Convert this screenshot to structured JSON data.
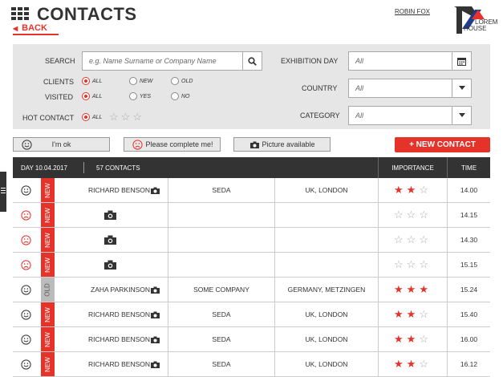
{
  "header": {
    "title": "CONTACTS",
    "back_label": "BACK",
    "user_name": "ROBIN FOX",
    "logo_line1": "LOREM",
    "logo_line2": "HOUSE"
  },
  "filters": {
    "search_label": "SEARCH",
    "search_placeholder": "e.g. Name Surname or Company Name",
    "clients_label": "CLIENTS",
    "visited_label": "VISITED",
    "hot_contact_label": "HOT CONTACT",
    "clients_options": [
      "ALL",
      "NEW",
      "OLD"
    ],
    "visited_options": [
      "ALL",
      "YES",
      "NO"
    ],
    "hot_option": "ALL",
    "exhibition_day_label": "EXHIBITION DAY",
    "exhibition_day_value": "All",
    "country_label": "COUNTRY",
    "country_value": "All",
    "category_label": "CATEGORY",
    "category_value": "All"
  },
  "legend": {
    "ok_label": "I'm ok",
    "complete_label": "Please complete me!",
    "picture_label": "Picture available",
    "new_contact_label": "+ NEW CONTACT"
  },
  "table": {
    "day_label": "DAY 10.04.2017",
    "count_label": "57 CONTACTS",
    "importance_header": "IMPORTANCE",
    "time_header": "TIME",
    "rows": [
      {
        "mood": "ok",
        "status": "NEW",
        "name": "RICHARD BENSON",
        "company": "SEDA",
        "location": "UK, LONDON",
        "stars": 2,
        "time": "14.00"
      },
      {
        "mood": "complete",
        "status": "NEW",
        "name": "",
        "company": "",
        "location": "",
        "stars": 0,
        "time": "14.15"
      },
      {
        "mood": "complete",
        "status": "NEW",
        "name": "",
        "company": "",
        "location": "",
        "stars": 0,
        "time": "14.30"
      },
      {
        "mood": "complete",
        "status": "NEW",
        "name": "",
        "company": "",
        "location": "",
        "stars": 0,
        "time": "15.15"
      },
      {
        "mood": "ok",
        "status": "OLD",
        "name": "ZAHA PARKINSON",
        "company": "SOME COMPANY",
        "location": "GERMANY, METZINGEN",
        "stars": 3,
        "time": "15.24"
      },
      {
        "mood": "ok",
        "status": "NEW",
        "name": "RICHARD BENSON",
        "company": "SEDA",
        "location": "UK, LONDON",
        "stars": 2,
        "time": "15.40"
      },
      {
        "mood": "ok",
        "status": "NEW",
        "name": "RICHARD BENSON",
        "company": "SEDA",
        "location": "UK, LONDON",
        "stars": 2,
        "time": "16.00"
      },
      {
        "mood": "ok",
        "status": "NEW",
        "name": "RICHARD BENSON",
        "company": "SEDA",
        "location": "UK, LONDON",
        "stars": 2,
        "time": "16.12"
      }
    ]
  },
  "colors": {
    "accent": "#e5332a",
    "dark": "#333333",
    "panel": "#e6e6e6",
    "logo_blue": "#1f3b8c"
  },
  "icons": {
    "grid": "grid-icon",
    "search": "search-icon",
    "calendar": "calendar-icon",
    "dropdown": "chevron-down-icon",
    "ok": "smiley-icon",
    "complete": "sad-face-icon",
    "picture": "camera-icon",
    "star": "star-icon"
  }
}
